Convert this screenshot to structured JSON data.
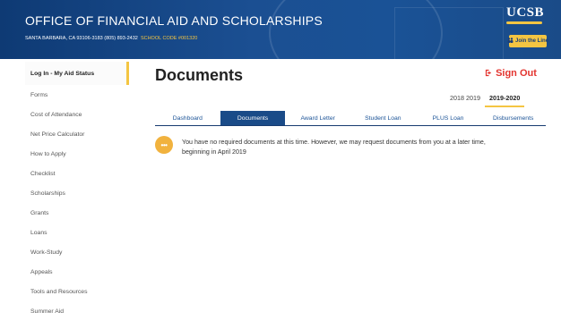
{
  "header": {
    "title": "OFFICE OF FINANCIAL AID AND SCHOLARSHIPS",
    "address": "SANTA BARBARA, CA 93106-3183  (805) 893-2432",
    "school_code": "SCHOOL CODE #001320",
    "logo": "UCSB",
    "join_line_label": "Join the Line",
    "join_line_icon": "people-icon"
  },
  "sidebar": {
    "items": [
      {
        "label": "Log In - My Aid Status",
        "active": true
      },
      {
        "label": "Forms"
      },
      {
        "label": "Cost of Attendance"
      },
      {
        "label": "Net Price Calculator"
      },
      {
        "label": "How to Apply"
      },
      {
        "label": "Checklist"
      },
      {
        "label": "Scholarships"
      },
      {
        "label": "Grants"
      },
      {
        "label": "Loans"
      },
      {
        "label": "Work-Study"
      },
      {
        "label": "Appeals"
      },
      {
        "label": "Tools and Resources"
      },
      {
        "label": "Summer Aid"
      }
    ]
  },
  "main": {
    "title": "Documents",
    "sign_out_label": "Sign Out",
    "sign_out_icon": "sign-out-icon",
    "years": [
      "2018 2019",
      "2019-2020"
    ],
    "active_year": "2019-2020",
    "tabs": [
      "Dashboard",
      "Documents",
      "Award Letter",
      "Student Loan",
      "PLUS Loan",
      "Disbursements"
    ],
    "active_tab": "Documents",
    "notice": {
      "icon": "more-dots-icon",
      "icon_text": "•••",
      "text": "You have no required documents at this time. However, we may request documents from you at a later time, beginning in April 2019"
    }
  },
  "colors": {
    "brand_navy": "#1a4b88",
    "accent_gold": "#f4c542",
    "sign_out_red": "#e3342f",
    "notice_orange": "#f1b23e"
  }
}
